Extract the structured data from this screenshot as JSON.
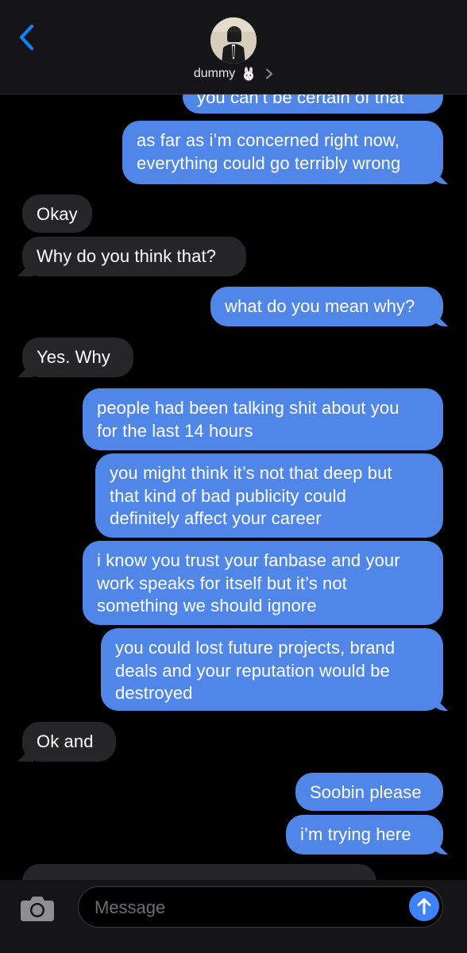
{
  "header": {
    "contact_name": "dummy",
    "contact_emoji": "rabbit-face-icon",
    "back_icon": "chevron-left-icon",
    "details_icon": "chevron-right-icon",
    "accent_color": "#0a84ff"
  },
  "messages": [
    {
      "direction": "out",
      "text": "you can’t be certain of that"
    },
    {
      "direction": "out",
      "text": "as far as i’m concerned right now,\neverything could go terribly wrong"
    },
    {
      "direction": "in",
      "text": "Okay"
    },
    {
      "direction": "in",
      "text": "Why do you think that?"
    },
    {
      "direction": "out",
      "text": "what do you mean why?"
    },
    {
      "direction": "in",
      "text": "Yes. Why"
    },
    {
      "direction": "out",
      "text": "people had been talking shit about you\nfor the last 14 hours"
    },
    {
      "direction": "out",
      "text": "you might think it’s not that deep but\nthat kind of bad publicity could\ndefinitely affect your career"
    },
    {
      "direction": "out",
      "text": "i know you trust your fanbase and your\nwork speaks for itself but it’s not\nsomething we should ignore"
    },
    {
      "direction": "out",
      "text": "you could lost future projects, brand\ndeals and your reputation would be\ndestroyed"
    },
    {
      "direction": "in",
      "text": "Ok and"
    },
    {
      "direction": "out",
      "text": "Soobin please"
    },
    {
      "direction": "out",
      "text": "i’m trying here"
    }
  ],
  "composer": {
    "placeholder": "Message",
    "value": "",
    "camera_icon": "camera-icon",
    "send_icon": "arrow-up-icon"
  },
  "colors": {
    "outgoing_bubble": "#4f86e7",
    "incoming_bubble": "#262628",
    "background": "#000000",
    "bar_background": "#151517"
  }
}
